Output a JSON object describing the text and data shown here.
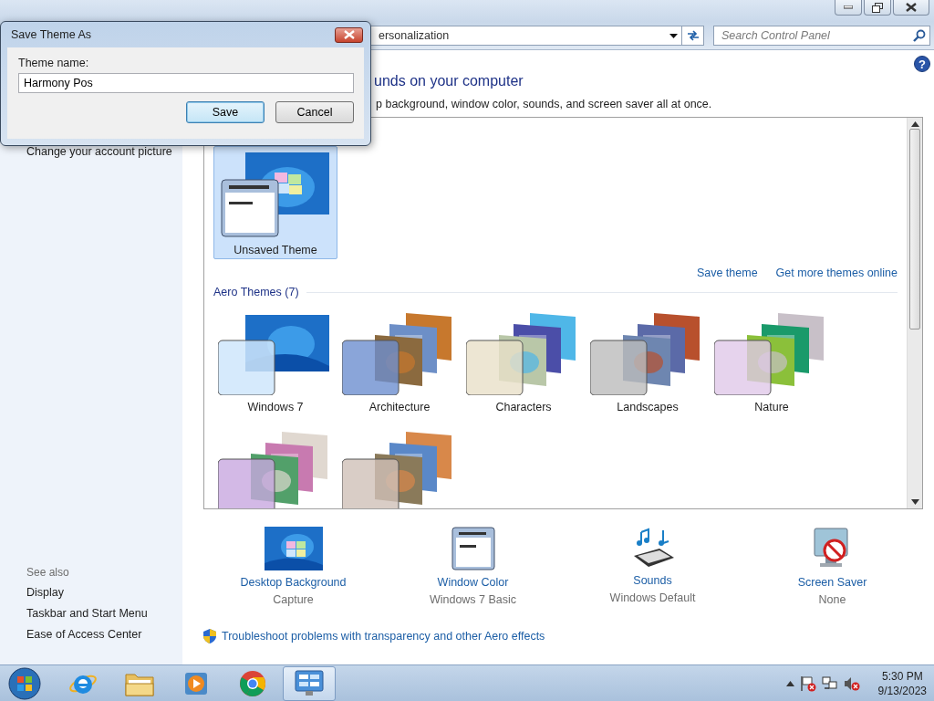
{
  "help": "?",
  "address_bar": {
    "path": "ersonalization",
    "search_placeholder": "Search Control Panel"
  },
  "sidebar": {
    "items": [
      {
        "label": "Change your account picture"
      }
    ],
    "see_also_title": "See also",
    "see_also": [
      {
        "label": "Display"
      },
      {
        "label": "Taskbar and Start Menu"
      },
      {
        "label": "Ease of Access Center"
      }
    ]
  },
  "main": {
    "heading": "unds on your computer",
    "description": "p background, window color, sounds, and screen saver all at once."
  },
  "my_themes": [
    {
      "label": "Unsaved Theme",
      "selected": true
    }
  ],
  "theme_links": [
    "Save theme",
    "Get more themes online"
  ],
  "aero_title": "Aero Themes (7)",
  "aero_themes": [
    {
      "label": "Windows 7",
      "selected": false
    },
    {
      "label": "Architecture",
      "selected": false
    },
    {
      "label": "Characters",
      "selected": false
    },
    {
      "label": "Landscapes",
      "selected": false
    },
    {
      "label": "Nature",
      "selected": false
    },
    {
      "selected": false
    },
    {
      "selected": false
    }
  ],
  "settings": [
    {
      "kind": "background",
      "label": "Desktop Background",
      "value": "Capture"
    },
    {
      "kind": "color",
      "label": "Window Color",
      "value": "Windows 7 Basic"
    },
    {
      "kind": "sounds",
      "label": "Sounds",
      "value": "Windows Default"
    },
    {
      "kind": "screensaver",
      "label": "Screen Saver",
      "value": "None"
    }
  ],
  "troubleshoot_link": "Troubleshoot problems with transparency and other Aero effects",
  "dialog": {
    "title": "Save Theme As",
    "label": "Theme name:",
    "value": "Harmony Pos",
    "buttons": [
      {
        "label": "Save",
        "default": true
      },
      {
        "label": "Cancel",
        "default": false
      }
    ]
  },
  "taskbar": {
    "apps": [
      {
        "kind": "ie",
        "active": false
      },
      {
        "kind": "explorer",
        "active": false
      },
      {
        "kind": "media",
        "active": false
      },
      {
        "kind": "chrome",
        "active": false
      },
      {
        "kind": "control",
        "active": true
      }
    ],
    "time": "5:30 PM",
    "date": "9/13/2023"
  }
}
